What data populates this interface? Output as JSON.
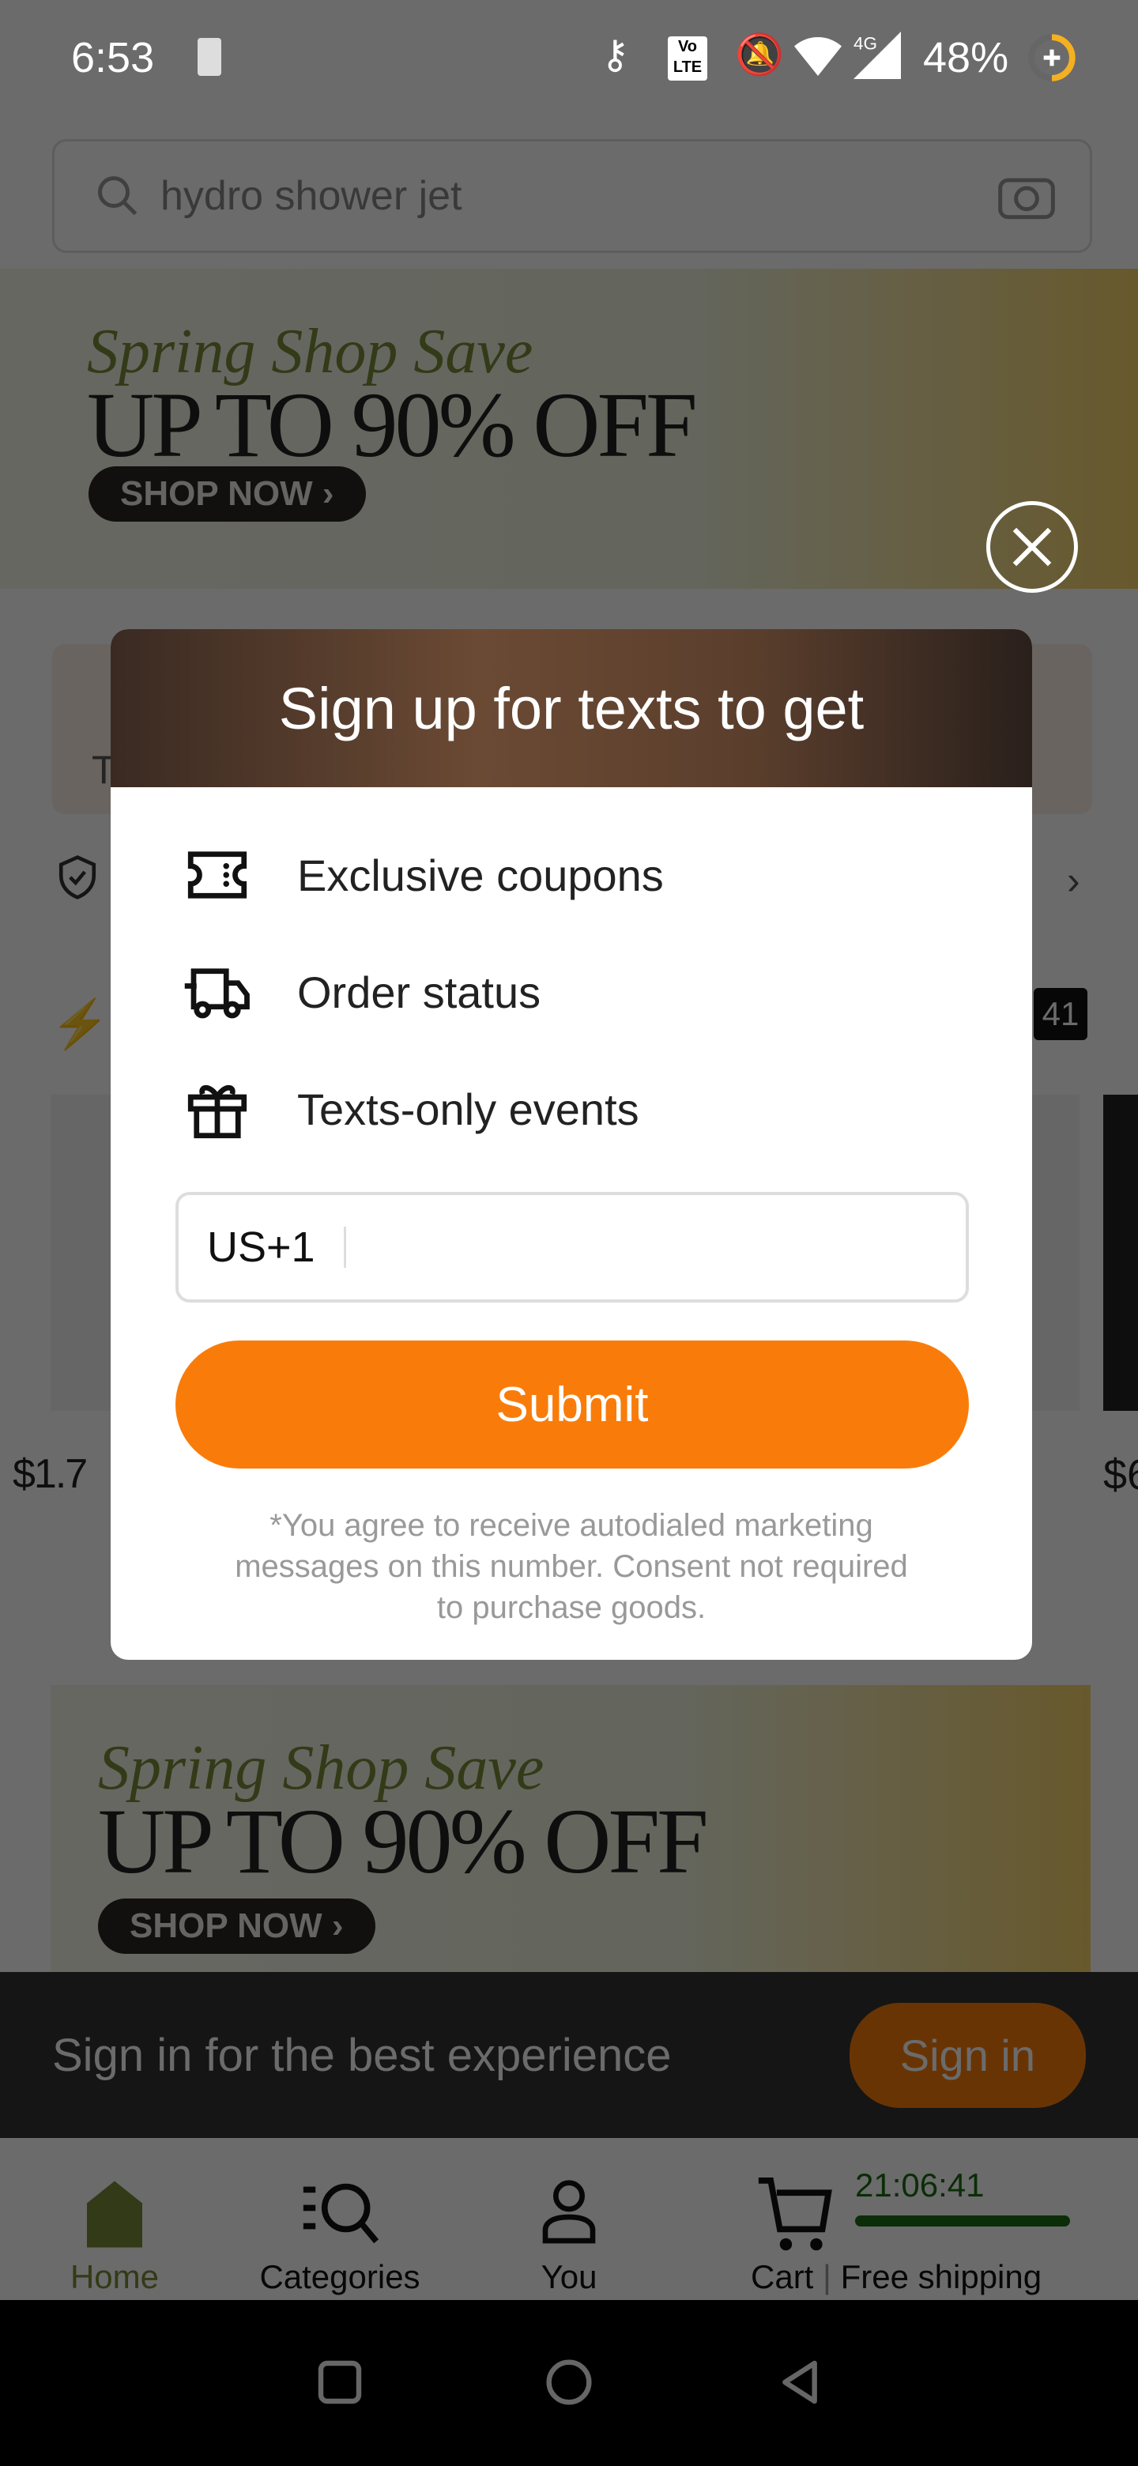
{
  "status_bar": {
    "time": "6:53",
    "battery": "48%",
    "network": "4G"
  },
  "search": {
    "placeholder": "hydro shower jet"
  },
  "banner": {
    "script": "Spring Shop Save",
    "headline": "UP TO 90% OFF",
    "cta": "SHOP NOW ›"
  },
  "background": {
    "card_letter": "T",
    "flash_count": "41",
    "prices": [
      "$1.7",
      "$6"
    ]
  },
  "modal": {
    "title": "Sign up for texts to get",
    "benefits": [
      {
        "icon": "coupon-icon",
        "label": "Exclusive coupons"
      },
      {
        "icon": "truck-icon",
        "label": "Order status"
      },
      {
        "icon": "gift-icon",
        "label": "Texts-only events"
      }
    ],
    "phone_prefix": "US+1",
    "phone_value": "",
    "submit_label": "Submit",
    "disclaimer": "*You agree to receive autodialed marketing messages on this number. Consent not required to purchase goods."
  },
  "signin_bar": {
    "text": "Sign in for the best experience",
    "button": "Sign in"
  },
  "bottom_nav": {
    "items": [
      {
        "label": "Home",
        "active": true
      },
      {
        "label": "Categories"
      },
      {
        "label": "You"
      },
      {
        "label": "Cart"
      }
    ],
    "timer": "21:06:41",
    "shipping": "Free shipping"
  },
  "colors": {
    "accent": "#f97c0a",
    "timer_green": "#1a6b12"
  }
}
